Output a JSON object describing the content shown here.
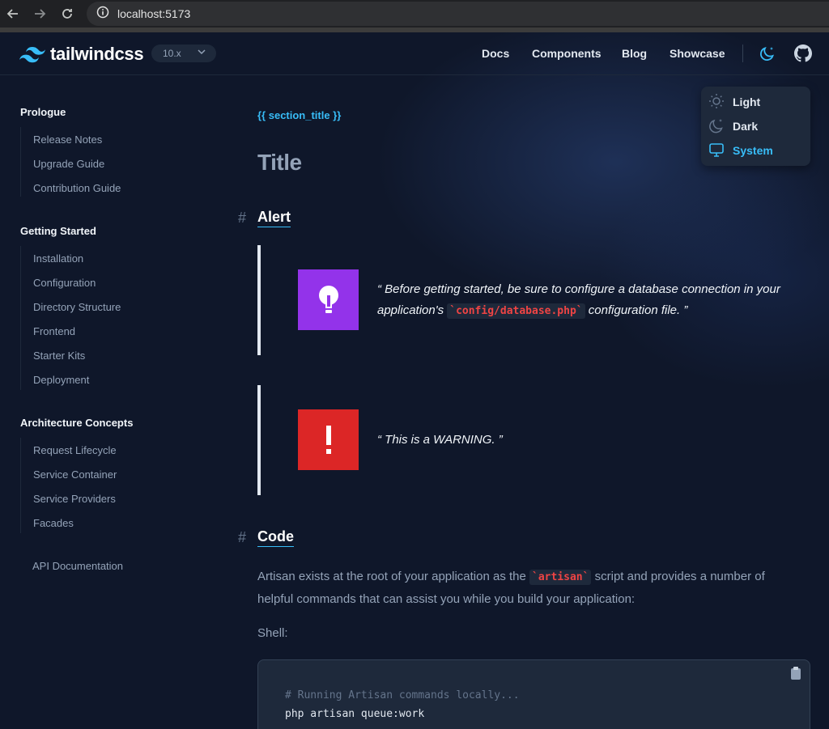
{
  "browser": {
    "url": "localhost:5173"
  },
  "header": {
    "logo_text": "tailwindcss",
    "version": "10.x",
    "nav": [
      "Docs",
      "Components",
      "Blog",
      "Showcase"
    ]
  },
  "sidebar": {
    "groups": [
      {
        "title": "Prologue",
        "items": [
          "Release Notes",
          "Upgrade Guide",
          "Contribution Guide"
        ]
      },
      {
        "title": "Getting Started",
        "items": [
          "Installation",
          "Configuration",
          "Directory Structure",
          "Frontend",
          "Starter Kits",
          "Deployment"
        ]
      },
      {
        "title": "Architecture Concepts",
        "items": [
          "Request Lifecycle",
          "Service Container",
          "Service Providers",
          "Facades"
        ]
      }
    ],
    "api_link": "API Documentation"
  },
  "content": {
    "section_title": "{{ section_title }}",
    "title": "Title",
    "alert_heading": "Alert",
    "alert_info": {
      "before": "“ Before getting started, be sure to configure a database connection in your application's ",
      "code": "`config/database.php`",
      "after": " configuration file. ”"
    },
    "alert_warning": "“ This is a WARNING. ”",
    "code_heading": "Code",
    "para": {
      "before": "Artisan exists at the root of your application as the ",
      "code": "`artisan`",
      "after": " script and provides a number of helpful commands that can assist you while you build your application:"
    },
    "shell_label": "Shell:",
    "code_lines": [
      "# Running Artisan commands locally...",
      "php artisan queue:work"
    ]
  },
  "theme_menu": {
    "options": [
      {
        "label": "Light",
        "icon": "sun-icon"
      },
      {
        "label": "Dark",
        "icon": "moon-icon"
      },
      {
        "label": "System",
        "icon": "monitor-icon",
        "selected": true
      }
    ]
  },
  "colors": {
    "accent": "#38bdf8",
    "info_alert": "#9333ea",
    "warning_alert": "#dc2626",
    "background": "#0f172a"
  }
}
